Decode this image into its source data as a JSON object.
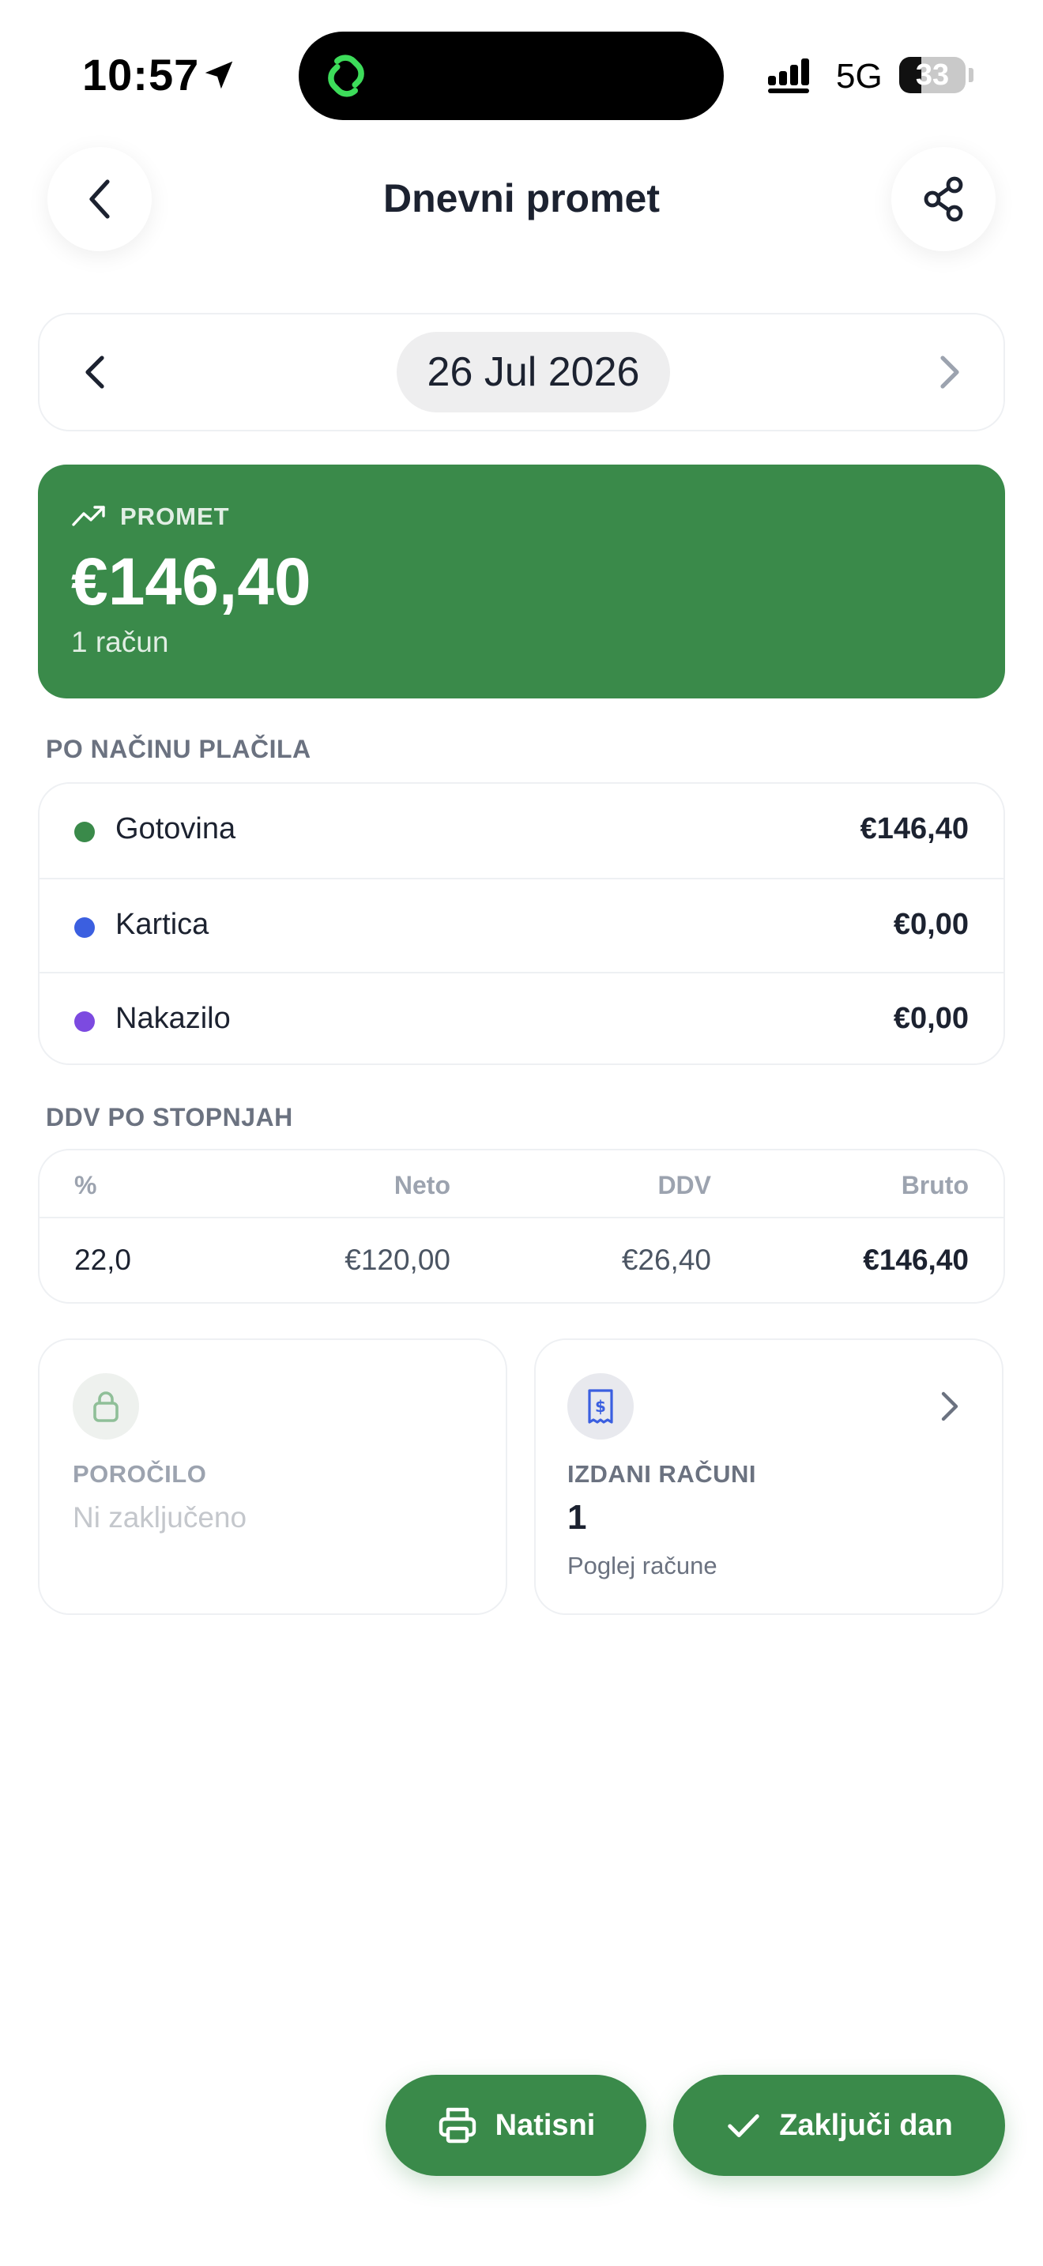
{
  "status_bar": {
    "time": "10:57",
    "network": "5G",
    "battery": "33",
    "battery_level": 0.33
  },
  "header": {
    "title": "Dnevni promet",
    "back_icon": "chevron-left-icon",
    "share_icon": "share-icon"
  },
  "date_selector": {
    "date": "26 Jul 2026"
  },
  "revenue": {
    "label": "PROMET",
    "amount": "€146,40",
    "count": "1 račun",
    "color": "#3a8a4a"
  },
  "payments": {
    "section_title": "PO NAČINU PLAČILA",
    "items": [
      {
        "name": "Gotovina",
        "value": "€146,40",
        "color": "#3a8a4a"
      },
      {
        "name": "Kartica",
        "value": "€0,00",
        "color": "#3b5fe0"
      },
      {
        "name": "Nakazilo",
        "value": "€0,00",
        "color": "#7c4ae0"
      }
    ]
  },
  "vat": {
    "section_title": "DDV PO STOPNJAH",
    "columns": [
      "%",
      "Neto",
      "DDV",
      "Bruto"
    ],
    "rows": [
      [
        "22,0",
        "€120,00",
        "€26,40",
        "€146,40"
      ]
    ]
  },
  "report_tile": {
    "label": "POROČILO",
    "status": "Ni zaključeno",
    "icon": "lock-icon"
  },
  "receipts_tile": {
    "label": "IZDANI RAČUNI",
    "count": "1",
    "link": "Poglej račune",
    "icon": "receipt-icon"
  },
  "actions": {
    "print_label": "Natisni",
    "close_day_label": "Zaključi dan"
  }
}
